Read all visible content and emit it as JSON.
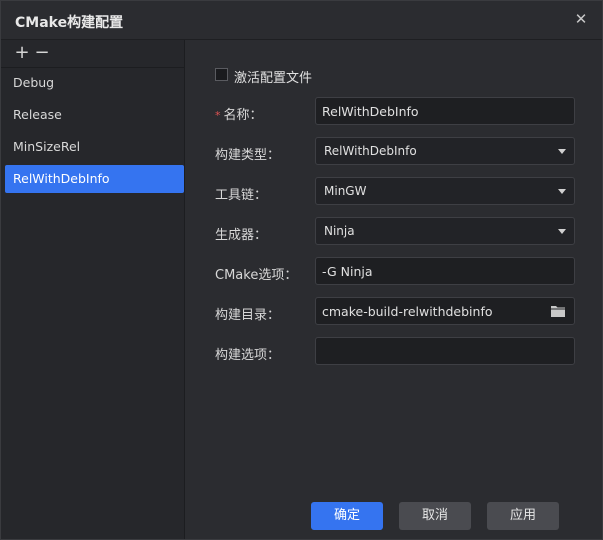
{
  "window": {
    "title": "CMake构建配置"
  },
  "sidebar": {
    "add_label": "+",
    "remove_label": "−",
    "items": [
      {
        "label": "Debug"
      },
      {
        "label": "Release"
      },
      {
        "label": "MinSizeRel"
      },
      {
        "label": "RelWithDebInfo",
        "selected": true
      }
    ]
  },
  "form": {
    "activate_label": "激活配置文件",
    "activate_checked": false,
    "required_mark": "*",
    "name_label": "名称：",
    "name_value": "RelWithDebInfo",
    "build_type_label": "构建类型：",
    "build_type_value": "RelWithDebInfo",
    "toolchain_label": "工具链：",
    "toolchain_value": "MinGW",
    "generator_label": "生成器：",
    "generator_value": "Ninja",
    "cmake_options_label": "CMake选项：",
    "cmake_options_value": "-G Ninja",
    "build_dir_label": "构建目录：",
    "build_dir_value": "cmake-build-relwithdebinfo",
    "build_options_label": "构建选项：",
    "build_options_value": ""
  },
  "buttons": {
    "ok": "确定",
    "cancel": "取消",
    "apply": "应用"
  },
  "colors": {
    "accent": "#3574f0",
    "required": "#e05252"
  }
}
